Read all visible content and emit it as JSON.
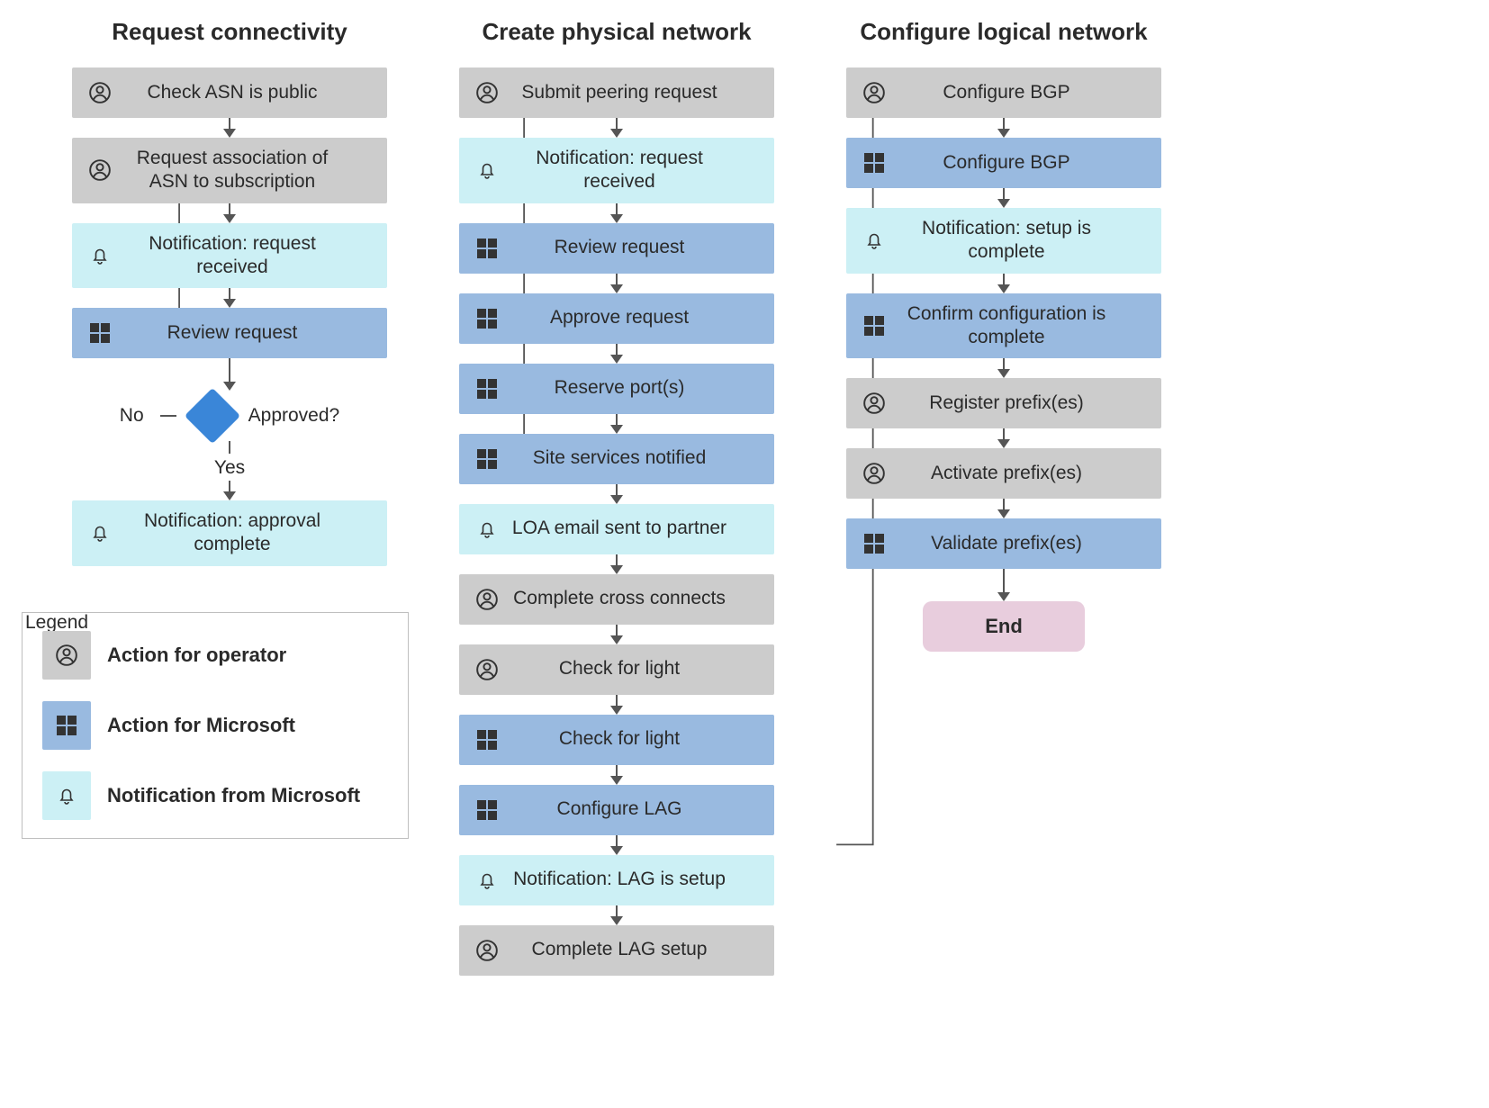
{
  "columns": {
    "c1": {
      "title": "Request connectivity"
    },
    "c2": {
      "title": "Create physical network"
    },
    "c3": {
      "title": "Configure logical network"
    }
  },
  "c1_nodes": {
    "n1": "Check ASN is public",
    "n2": "Request association of ASN to subscription",
    "n3": "Notification: request received",
    "n4": "Review request",
    "n5": "Notification: approval complete"
  },
  "c1_decision": {
    "question": "Approved?",
    "no": "No",
    "yes": "Yes"
  },
  "c2_nodes": {
    "n1": "Submit peering request",
    "n2": "Notification: request received",
    "n3": "Review request",
    "n4": "Approve request",
    "n5": "Reserve port(s)",
    "n6": "Site services notified",
    "n7": "LOA email sent to partner",
    "n8": "Complete cross connects",
    "n9": "Check for light",
    "n10": "Check for light",
    "n11": "Configure LAG",
    "n12": "Notification: LAG is setup",
    "n13": "Complete LAG setup"
  },
  "c3_nodes": {
    "n1": "Configure BGP",
    "n2": "Configure BGP",
    "n3": "Notification: setup is complete",
    "n4": "Confirm configuration is complete",
    "n5": "Register prefix(es)",
    "n6": "Activate prefix(es)",
    "n7": "Validate prefix(es)"
  },
  "end_label": "End",
  "legend": {
    "title": "Legend",
    "operator": "Action for operator",
    "microsoft": "Action for Microsoft",
    "notify": "Notification from Microsoft"
  },
  "colors": {
    "operator": "#cccccc",
    "microsoft": "#99bae0",
    "notify": "#ccf0f5",
    "diamond": "#3a86d8",
    "end": "#e8cddd"
  }
}
